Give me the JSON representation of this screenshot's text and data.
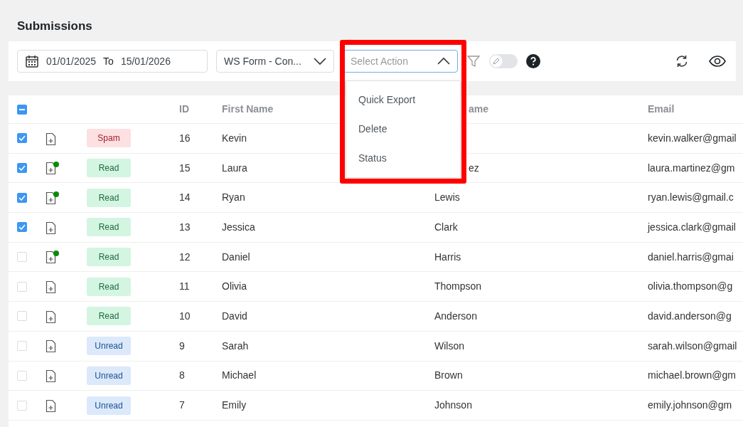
{
  "title": "Submissions",
  "toolbar": {
    "date_from": "01/01/2025",
    "date_to_label": "To",
    "date_to": "15/01/2026",
    "form_select": "WS Form - Con...",
    "action_select": {
      "placeholder": "Select Action",
      "expanded": true,
      "options": [
        "Quick Export",
        "Delete",
        "Status"
      ]
    },
    "toggle_on": false
  },
  "table": {
    "select_all": {
      "checked": true,
      "indeterminate": true
    },
    "columns": [
      "ID",
      "First Name",
      "ame",
      "Email"
    ],
    "rows": [
      {
        "checked": true,
        "note": false,
        "status": {
          "kind": "spam",
          "label": "Spam"
        },
        "id": "16",
        "first": "Kevin",
        "last": "",
        "email": "kevin.walker@gmail"
      },
      {
        "checked": true,
        "note": true,
        "status": {
          "kind": "read",
          "label": "Read"
        },
        "id": "15",
        "first": "Laura",
        "last": "ez",
        "email": "laura.martinez@gm"
      },
      {
        "checked": true,
        "note": true,
        "status": {
          "kind": "read",
          "label": "Read"
        },
        "id": "14",
        "first": "Ryan",
        "last": "Lewis",
        "email": "ryan.lewis@gmail.c"
      },
      {
        "checked": true,
        "note": false,
        "status": {
          "kind": "read",
          "label": "Read"
        },
        "id": "13",
        "first": "Jessica",
        "last": "Clark",
        "email": "jessica.clark@gmail"
      },
      {
        "checked": false,
        "note": true,
        "status": {
          "kind": "read",
          "label": "Read"
        },
        "id": "12",
        "first": "Daniel",
        "last": "Harris",
        "email": "daniel.harris@gmai"
      },
      {
        "checked": false,
        "note": false,
        "status": {
          "kind": "read",
          "label": "Read"
        },
        "id": "11",
        "first": "Olivia",
        "last": "Thompson",
        "email": "olivia.thompson@g"
      },
      {
        "checked": false,
        "note": false,
        "status": {
          "kind": "read",
          "label": "Read"
        },
        "id": "10",
        "first": "David",
        "last": "Anderson",
        "email": "david.anderson@g"
      },
      {
        "checked": false,
        "note": false,
        "status": {
          "kind": "unread",
          "label": "Unread"
        },
        "id": "9",
        "first": "Sarah",
        "last": "Wilson",
        "email": "sarah.wilson@gmail"
      },
      {
        "checked": false,
        "note": false,
        "status": {
          "kind": "unread",
          "label": "Unread"
        },
        "id": "8",
        "first": "Michael",
        "last": "Brown",
        "email": "michael.brown@gm"
      },
      {
        "checked": false,
        "note": false,
        "status": {
          "kind": "unread",
          "label": "Unread"
        },
        "id": "7",
        "first": "Emily",
        "last": "Johnson",
        "email": "emily.johnson@gm"
      }
    ]
  }
}
